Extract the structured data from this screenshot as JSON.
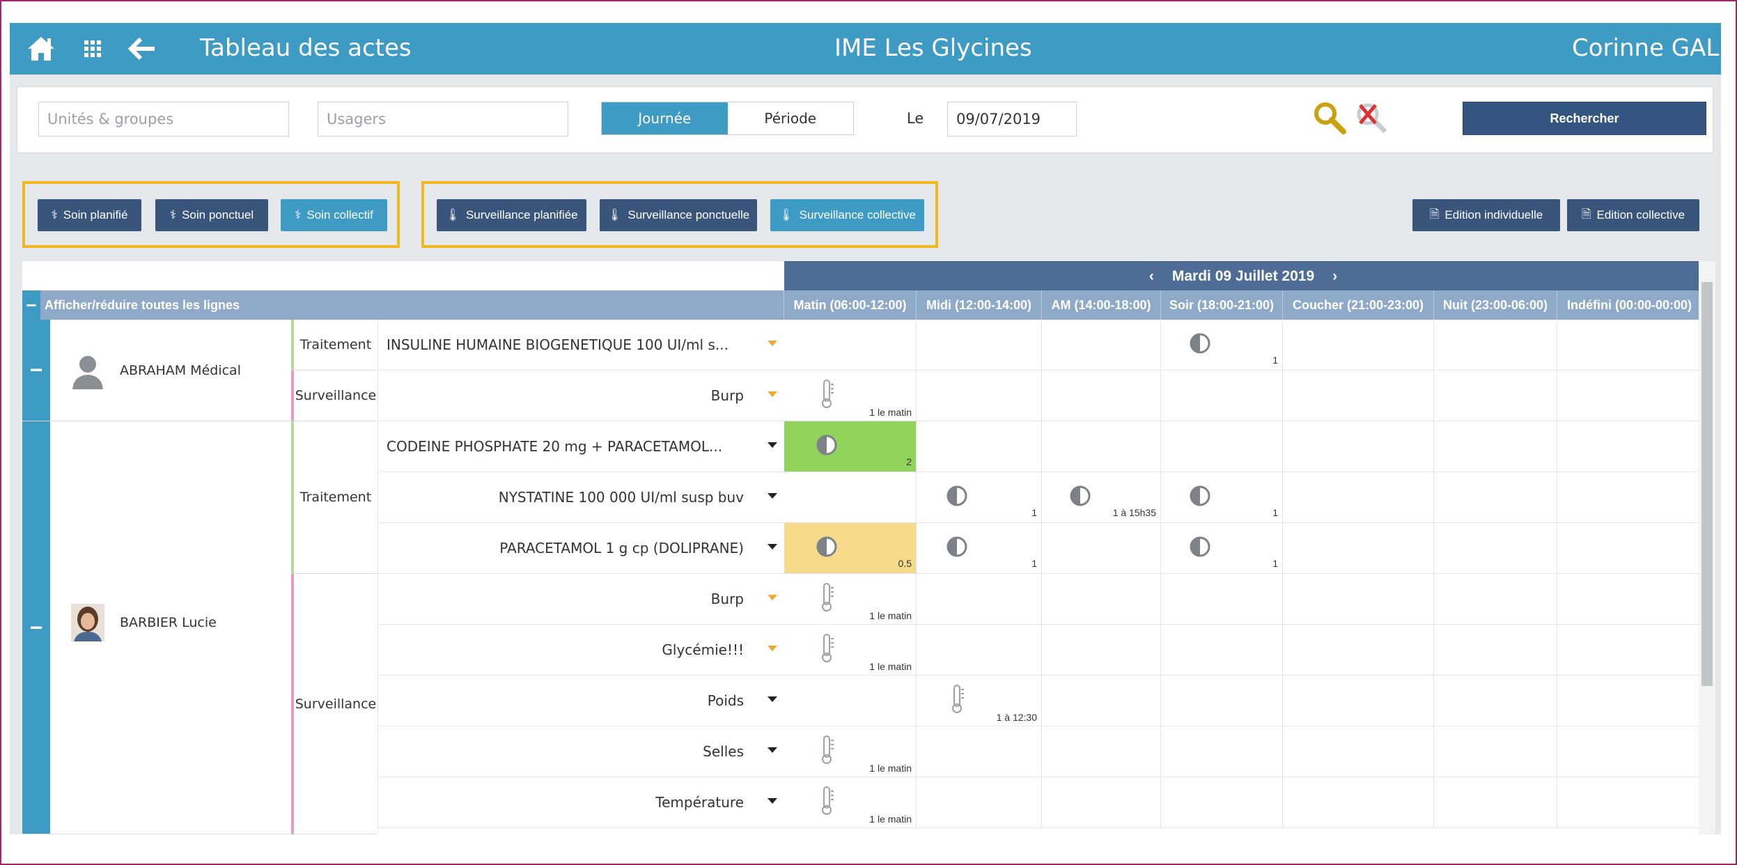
{
  "header": {
    "title": "Tableau des actes",
    "center_title": "IME Les Glycines",
    "user": "Corinne GALLO"
  },
  "search": {
    "units_placeholder": "Unités & groupes",
    "users_placeholder": "Usagers",
    "mode_day": "Journée",
    "mode_period": "Période",
    "date_label": "Le",
    "date_value": "09/07/2019",
    "search_button": "Rechercher"
  },
  "toolbar": {
    "soin_planifie": "Soin planifié",
    "soin_ponctuel": "Soin ponctuel",
    "soin_collectif": "Soin collectif",
    "surv_planifiee": "Surveillance planifiée",
    "surv_ponctuelle": "Surveillance ponctuelle",
    "surv_collective": "Surveillance collective",
    "edition_individuelle": "Edition individuelle",
    "edition_collective": "Edition collective"
  },
  "grid": {
    "day_label": "Mardi 09 Juillet 2019",
    "toggle_all": "Afficher/réduire toutes les lignes",
    "columns": [
      "Matin (06:00-12:00)",
      "Midi (12:00-14:00)",
      "AM (14:00-18:00)",
      "Soir (18:00-21:00)",
      "Coucher (21:00-23:00)",
      "Nuit (23:00-06:00)",
      "Indéfini (00:00-00:00)"
    ],
    "patients": [
      {
        "name": "ABRAHAM Médical"
      },
      {
        "name": "BARBIER Lucie"
      }
    ],
    "types": {
      "treatment": "Traitement",
      "surveillance": "Surveillance"
    },
    "rows": [
      {
        "label": "INSULINE HUMAINE BIOGENETIQUE 100 UI/ml s...",
        "caret": "orange"
      },
      {
        "label": "Burp",
        "caret": "orange"
      },
      {
        "label": "CODEINE PHOSPHATE 20 mg + PARACETAMOL...",
        "caret": "black"
      },
      {
        "label": "NYSTATINE 100 000 UI/ml susp buv",
        "caret": "black"
      },
      {
        "label": "PARACETAMOL 1 g cp (DOLIPRANE)",
        "caret": "black"
      },
      {
        "label": "Burp",
        "caret": "orange"
      },
      {
        "label": "Glycémie!!!",
        "caret": "orange"
      },
      {
        "label": "Poids",
        "caret": "black"
      },
      {
        "label": "Selles",
        "caret": "black"
      },
      {
        "label": "Température",
        "caret": "black"
      }
    ],
    "cells": {
      "r0_soir": "1",
      "r1_matin": "1 le matin",
      "r2_matin": "2",
      "r3_midi": "1",
      "r3_am": "1 à 15h35",
      "r3_soir": "1",
      "r4_matin": "0.5",
      "r4_midi": "1",
      "r4_soir": "1",
      "r5_matin": "1 le matin",
      "r6_matin": "1 le matin",
      "r7_midi": "1 à 12:30",
      "r8_matin": "1 le matin",
      "r9_matin": "1 le matin"
    }
  },
  "colors": {
    "header": "#3d9bc4",
    "dark_button": "#34557f",
    "green_cell": "#8fd35b",
    "yellow_cell": "#f7d98a",
    "highlight": "#f1b81f"
  }
}
